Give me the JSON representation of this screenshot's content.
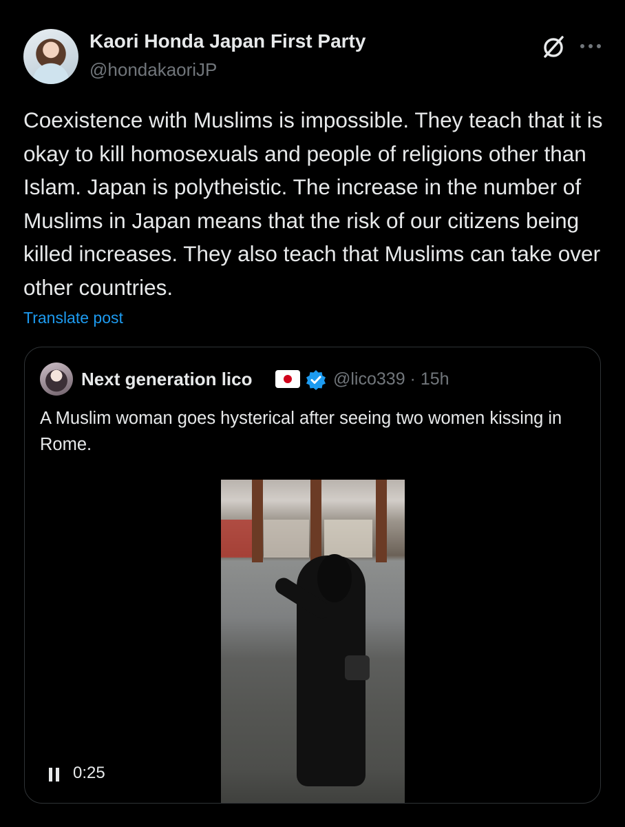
{
  "post": {
    "display_name": "Kaori Honda Japan First Party",
    "handle": "@hondakaoriJP",
    "text": "Coexistence with Muslims is impossible. They teach that it is okay to kill homosexuals and people of religions other than Islam. Japan is polytheistic. The increase in the number of Muslims in Japan means that the risk of our citizens being killed increases. They also teach that Muslims can take over other countries.",
    "translate_label": "Translate post",
    "icons": [
      "grok-icon",
      "more-icon"
    ]
  },
  "quote": {
    "display_name": "Next generation lico",
    "flag": "japan-flag-icon",
    "verified": true,
    "meta": "@lico339 · 15h",
    "text": "A Muslim woman goes hysterical after seeing two women kissing in Rome.",
    "video": {
      "time": "0:25",
      "state_icon": "pause-icon"
    }
  },
  "colors": {
    "background": "#000000",
    "text": "#e7e9ea",
    "muted": "#71767b",
    "link": "#1d9bf0",
    "border": "#2f3336",
    "verified": "#1d9bf0"
  }
}
